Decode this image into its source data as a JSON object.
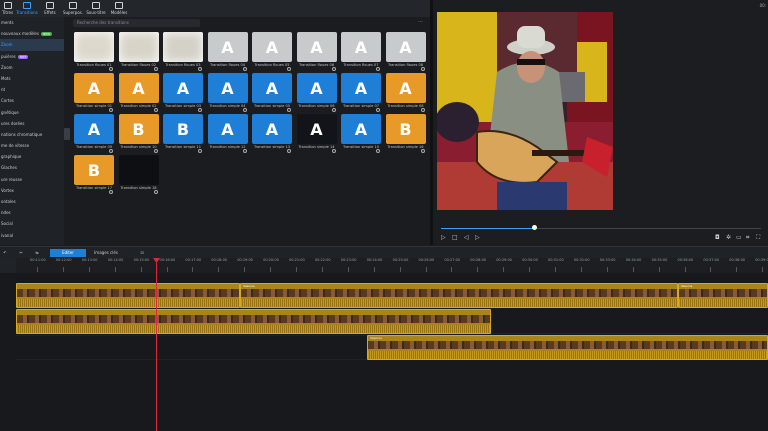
{
  "toolbar": {
    "tabs": [
      {
        "label": "Titres"
      },
      {
        "label": "Transitions"
      },
      {
        "label": "Effets"
      },
      {
        "label": "Superpos."
      },
      {
        "label": "Sous-titre"
      },
      {
        "label": "Modèles"
      }
    ]
  },
  "categories": [
    {
      "label": "ments"
    },
    {
      "label": "nouveaux modèles",
      "badge": "NEW",
      "badge_color": "#4caf50"
    },
    {
      "label": "Zoom"
    },
    {
      "label": "puières",
      "badge": "HOT",
      "badge_color": "#9c6bff"
    },
    {
      "label": "Zoom"
    },
    {
      "label": "Mots"
    },
    {
      "label": "nt"
    },
    {
      "label": "Cortes"
    },
    {
      "label": "gnétique"
    },
    {
      "label": "ures dorées"
    },
    {
      "label": "nations chromatique"
    },
    {
      "label": "me de vitesse"
    },
    {
      "label": "graphique"
    },
    {
      "label": "Glaches"
    },
    {
      "label": "ure reusse"
    },
    {
      "label": "Vortex"
    },
    {
      "label": "ontales"
    },
    {
      "label": "ndes"
    },
    {
      "label": "Social"
    },
    {
      "label": "ivanal"
    }
  ],
  "library": {
    "search_placeholder": "Recherche des transitions",
    "more_icon": "ellipsis-icon",
    "items": [
      {
        "label": "Transition floues 01",
        "bg": "#ddd8cc",
        "glyph": ""
      },
      {
        "label": "Transition floues 02",
        "bg": "#d8d4c8",
        "glyph": ""
      },
      {
        "label": "Transition floues 03",
        "bg": "#d4d1c8",
        "glyph": ""
      },
      {
        "label": "Transition floues 04",
        "bg": "#c8cbcc",
        "glyph": "A"
      },
      {
        "label": "Transition floues 05",
        "bg": "#c8cbcc",
        "glyph": "A"
      },
      {
        "label": "Transition floues 06",
        "bg": "#c8cbcc",
        "glyph": "A"
      },
      {
        "label": "Transition floues 07",
        "bg": "#c8cbcc",
        "glyph": "A"
      },
      {
        "label": "Transition floues 08",
        "bg": "#c8cbcc",
        "glyph": "A"
      },
      {
        "label": "Transition simple 01",
        "bg": "#e89a28",
        "glyph": "A"
      },
      {
        "label": "Transition simple 02",
        "bg": "#e89a28",
        "glyph": "A"
      },
      {
        "label": "Transition simple 03",
        "bg": "#1f7fd6",
        "glyph": "A"
      },
      {
        "label": "Transition simple 04",
        "bg": "#1f7fd6",
        "glyph": "A"
      },
      {
        "label": "Transition simple 05",
        "bg": "#1f7fd6",
        "glyph": "A"
      },
      {
        "label": "Transition simple 06",
        "bg": "#1f7fd6",
        "glyph": "A"
      },
      {
        "label": "Transition simple 07",
        "bg": "#1f7fd6",
        "glyph": "A"
      },
      {
        "label": "Transition simple 08",
        "bg": "#e89a28",
        "glyph": "A"
      },
      {
        "label": "Transition simple 09",
        "bg": "#1f7fd6",
        "glyph": "A"
      },
      {
        "label": "Transition simple 10",
        "bg": "#e89a28",
        "glyph": "B"
      },
      {
        "label": "Transition simple 11",
        "bg": "#1f7fd6",
        "glyph": "B"
      },
      {
        "label": "Transition simple 12",
        "bg": "#1f7fd6",
        "glyph": "A"
      },
      {
        "label": "Transition simple 13",
        "bg": "#1f7fd6",
        "glyph": "A"
      },
      {
        "label": "Transition simple 14",
        "bg": "#111418",
        "glyph": "A"
      },
      {
        "label": "Transition simple 15",
        "bg": "#1f7fd6",
        "glyph": "A"
      },
      {
        "label": "Transition simple 16",
        "bg": "#e89a28",
        "glyph": "B"
      },
      {
        "label": "Transition simple 17",
        "bg": "#e89a28",
        "glyph": "B"
      },
      {
        "label": "Transition simple 18",
        "bg": "#0d0f12",
        "glyph": ""
      }
    ]
  },
  "preview": {
    "time": "00:",
    "progress": 0.29
  },
  "timeline": {
    "tabs": [
      {
        "label": "Editer",
        "active": true
      },
      {
        "label": "Images clés",
        "active": false
      }
    ],
    "ticks": [
      "00:11:00",
      "00:12:00",
      "00:13:00",
      "00:14:00",
      "00:15:00",
      "00:16:00",
      "00:17:00",
      "00:18:00",
      "00:19:00",
      "00:20:00",
      "00:21:00",
      "00:22:00",
      "00:23:00",
      "00:24:00",
      "00:25:00",
      "00:26:00",
      "00:27:00",
      "00:28:00",
      "00:29:00",
      "00:30:00",
      "00:31:00",
      "00:32:00",
      "00:33:00",
      "00:34:00",
      "00:35:00",
      "00:36:00",
      "00:37:00",
      "00:38:00",
      "00:39:00"
    ],
    "tracks": [
      {
        "clips": [
          {
            "name": "",
            "start": 0,
            "end": 0.298
          },
          {
            "name": "Vasoros",
            "start": 0.298,
            "end": 0.88
          },
          {
            "name": "Vasoros",
            "start": 0.88,
            "end": 1.0
          }
        ]
      },
      {
        "clips": [
          {
            "name": "",
            "start": 0,
            "end": 0.632
          }
        ]
      },
      {
        "clips": []
      },
      {
        "clips": [
          {
            "name": "Vasoros",
            "start": 0.467,
            "end": 1.0
          }
        ]
      }
    ]
  },
  "colors": {
    "accent": "#3aa0ff",
    "clip": "#a98418",
    "playhead": "#e0283a"
  }
}
